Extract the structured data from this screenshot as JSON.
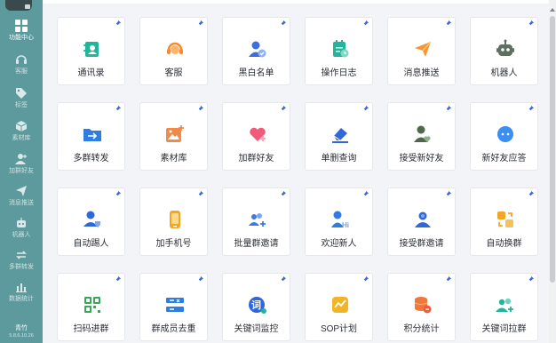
{
  "sidebar": {
    "items": [
      {
        "label": "功能中心",
        "icon": "grid-icon"
      },
      {
        "label": "客服",
        "icon": "headset-icon"
      },
      {
        "label": "标签",
        "icon": "tag-icon"
      },
      {
        "label": "素材库",
        "icon": "cube-icon"
      },
      {
        "label": "加群好友",
        "icon": "add-friend-icon"
      },
      {
        "label": "消息推送",
        "icon": "send-icon"
      },
      {
        "label": "机器人",
        "icon": "robot-icon"
      },
      {
        "label": "多群转发",
        "icon": "repeat-icon"
      },
      {
        "label": "数据统计",
        "icon": "bar-chart-icon"
      }
    ],
    "user": {
      "name": "青竹",
      "version": "5.8.6.10.26"
    }
  },
  "cards": [
    {
      "label": "通讯录",
      "icon": "contacts-icon"
    },
    {
      "label": "客服",
      "icon": "customer-service-icon"
    },
    {
      "label": "黑白名单",
      "icon": "blacklist-icon"
    },
    {
      "label": "操作日志",
      "icon": "operation-log-icon"
    },
    {
      "label": "消息推送",
      "icon": "paper-plane-icon"
    },
    {
      "label": "机器人",
      "icon": "robot-icon"
    },
    {
      "label": "多群转发",
      "icon": "folder-forward-icon"
    },
    {
      "label": "素材库",
      "icon": "image-material-icon"
    },
    {
      "label": "加群好友",
      "icon": "heart-plus-icon"
    },
    {
      "label": "单删查询",
      "icon": "eraser-icon"
    },
    {
      "label": "接受新好友",
      "icon": "accept-friend-icon"
    },
    {
      "label": "新好友应答",
      "icon": "chat-bubble-icon"
    },
    {
      "label": "自动踢人",
      "icon": "kick-user-icon"
    },
    {
      "label": "加手机号",
      "icon": "phone-icon"
    },
    {
      "label": "批量群邀请",
      "icon": "group-invite-icon"
    },
    {
      "label": "欢迎新人",
      "icon": "welcome-icon"
    },
    {
      "label": "接受群邀请",
      "icon": "accept-group-icon"
    },
    {
      "label": "自动换群",
      "icon": "switch-group-icon"
    },
    {
      "label": "扫码进群",
      "icon": "qr-code-icon"
    },
    {
      "label": "群成员去重",
      "icon": "dedupe-icon"
    },
    {
      "label": "关键词监控",
      "icon": "keyword-monitor-icon"
    },
    {
      "label": "SOP计划",
      "icon": "sop-plan-icon"
    },
    {
      "label": "积分统计",
      "icon": "points-icon"
    },
    {
      "label": "关键词拉群",
      "icon": "keyword-group-icon"
    }
  ],
  "colors": {
    "sidebar": "#5c9a9d",
    "pin": "#3b68d8",
    "page_bg": "#f2f4f7"
  }
}
